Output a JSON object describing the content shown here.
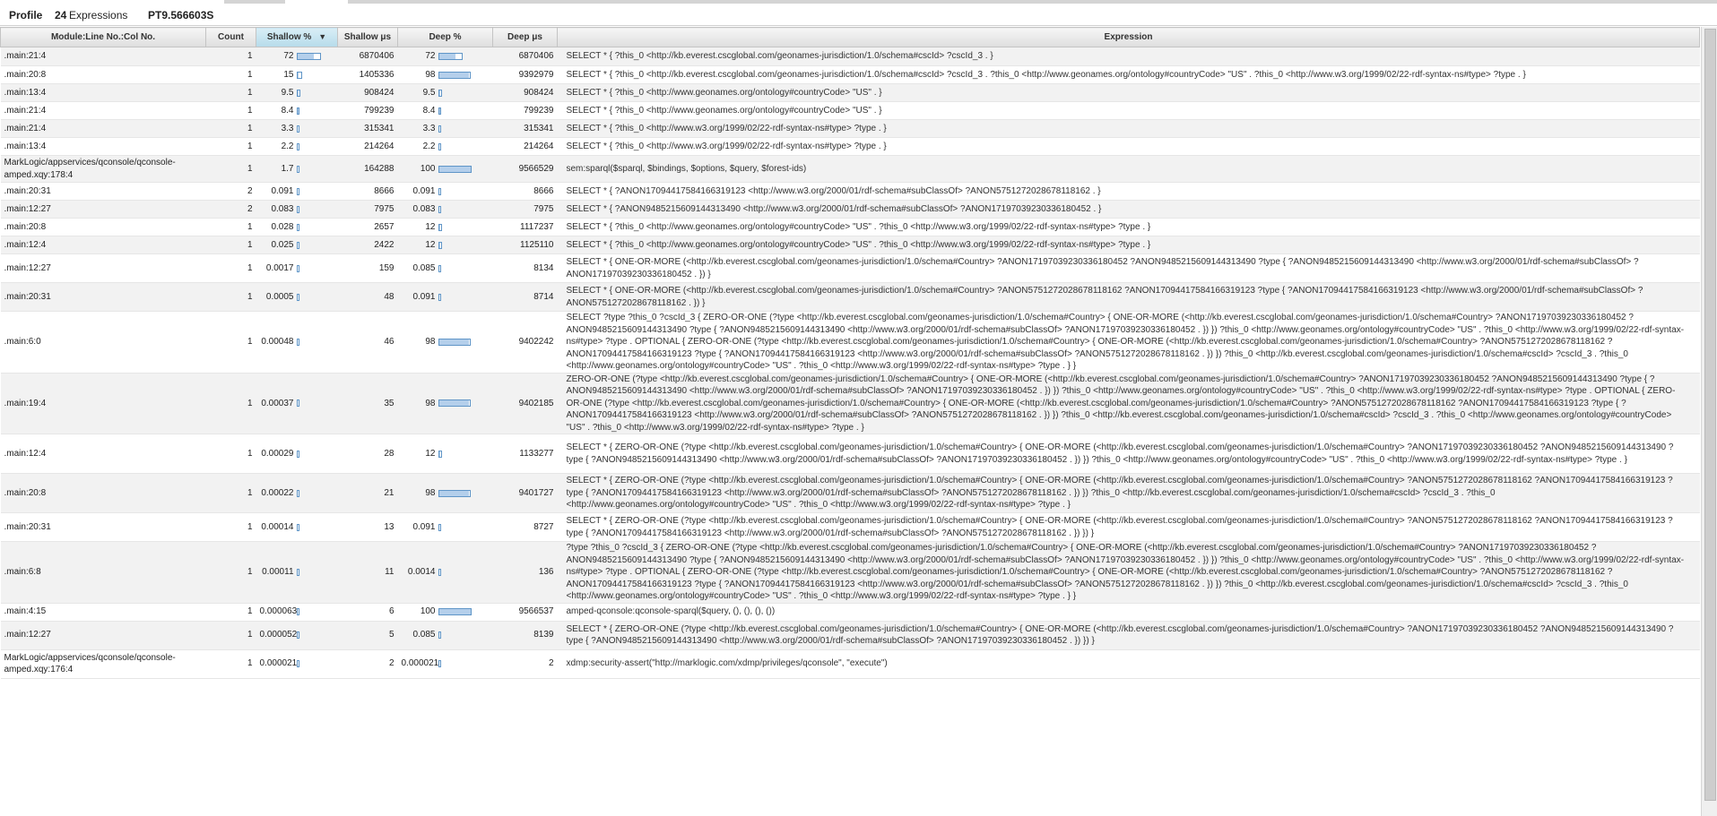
{
  "header": {
    "title": "Profile",
    "expression_count": "24",
    "expressions_label": "Expressions",
    "elapsed": "PT9.566603S"
  },
  "columns": {
    "module": "Module:Line No.:Col No.",
    "count": "Count",
    "shallow_pct": "Shallow %",
    "shallow_us": "Shallow μs",
    "deep_pct": "Deep %",
    "deep_us": "Deep μs",
    "expression": "Expression"
  },
  "sort": {
    "column": "shallow_pct",
    "direction": "descending",
    "arrow": "▼"
  },
  "rows": [
    {
      "module": ".main:21:4",
      "count": "1",
      "shallow_pct": "72",
      "shallow_fill": 0.72,
      "shallow_us": "6870406",
      "deep_pct": "72",
      "deep_fill": 0.72,
      "deep_us": "6870406",
      "expression": "SELECT * { ?this_0 <http://kb.everest.cscglobal.com/geonames-jurisdiction/1.0/schema#cscId> ?cscId_3 . }"
    },
    {
      "module": ".main:20:8",
      "count": "1",
      "shallow_pct": "15",
      "shallow_fill": 0.15,
      "shallow_us": "1405336",
      "deep_pct": "98",
      "deep_fill": 0.98,
      "deep_us": "9392979",
      "expression": "SELECT * { ?this_0 <http://kb.everest.cscglobal.com/geonames-jurisdiction/1.0/schema#cscId> ?cscId_3 . ?this_0 <http://www.geonames.org/ontology#countryCode> \"US\" . ?this_0 <http://www.w3.org/1999/02/22-rdf-syntax-ns#type> ?type . }"
    },
    {
      "module": ".main:13:4",
      "count": "1",
      "shallow_pct": "9.5",
      "shallow_fill": 0.095,
      "shallow_us": "908424",
      "deep_pct": "9.5",
      "deep_fill": 0.095,
      "deep_us": "908424",
      "expression": "SELECT * { ?this_0 <http://www.geonames.org/ontology#countryCode> \"US\" . }"
    },
    {
      "module": ".main:21:4",
      "count": "1",
      "shallow_pct": "8.4",
      "shallow_fill": 0.084,
      "shallow_us": "799239",
      "deep_pct": "8.4",
      "deep_fill": 0.084,
      "deep_us": "799239",
      "expression": "SELECT * { ?this_0 <http://www.geonames.org/ontology#countryCode> \"US\" . }"
    },
    {
      "module": ".main:21:4",
      "count": "1",
      "shallow_pct": "3.3",
      "shallow_fill": 0.033,
      "shallow_us": "315341",
      "deep_pct": "3.3",
      "deep_fill": 0.033,
      "deep_us": "315341",
      "expression": "SELECT * { ?this_0 <http://www.w3.org/1999/02/22-rdf-syntax-ns#type> ?type . }"
    },
    {
      "module": ".main:13:4",
      "count": "1",
      "shallow_pct": "2.2",
      "shallow_fill": 0.022,
      "shallow_us": "214264",
      "deep_pct": "2.2",
      "deep_fill": 0.022,
      "deep_us": "214264",
      "expression": "SELECT * { ?this_0 <http://www.w3.org/1999/02/22-rdf-syntax-ns#type> ?type . }"
    },
    {
      "module": "MarkLogic/appservices/qconsole/qconsole-amped.xqy:178:4",
      "count": "1",
      "shallow_pct": "1.7",
      "shallow_fill": 0.017,
      "shallow_us": "164288",
      "deep_pct": "100",
      "deep_fill": 1.0,
      "deep_us": "9566529",
      "expression": "sem:sparql($sparql, $bindings, $options, $query, $forest-ids)"
    },
    {
      "module": ".main:20:31",
      "count": "2",
      "shallow_pct": "0.091",
      "shallow_fill": 0.00091,
      "shallow_us": "8666",
      "deep_pct": "0.091",
      "deep_fill": 0.00091,
      "deep_us": "8666",
      "expression": "SELECT * { ?ANON17094417584166319123 <http://www.w3.org/2000/01/rdf-schema#subClassOf> ?ANON5751272028678118162 . }"
    },
    {
      "module": ".main:12:27",
      "count": "2",
      "shallow_pct": "0.083",
      "shallow_fill": 0.00083,
      "shallow_us": "7975",
      "deep_pct": "0.083",
      "deep_fill": 0.00083,
      "deep_us": "7975",
      "expression": "SELECT * { ?ANON9485215609144313490 <http://www.w3.org/2000/01/rdf-schema#subClassOf> ?ANON17197039230336180452 . }"
    },
    {
      "module": ".main:20:8",
      "count": "1",
      "shallow_pct": "0.028",
      "shallow_fill": 0.00028,
      "shallow_us": "2657",
      "deep_pct": "12",
      "deep_fill": 0.12,
      "deep_us": "1117237",
      "expression": "SELECT * { ?this_0 <http://www.geonames.org/ontology#countryCode> \"US\" . ?this_0 <http://www.w3.org/1999/02/22-rdf-syntax-ns#type> ?type . }"
    },
    {
      "module": ".main:12:4",
      "count": "1",
      "shallow_pct": "0.025",
      "shallow_fill": 0.00025,
      "shallow_us": "2422",
      "deep_pct": "12",
      "deep_fill": 0.12,
      "deep_us": "1125110",
      "expression": "SELECT * { ?this_0 <http://www.geonames.org/ontology#countryCode> \"US\" . ?this_0 <http://www.w3.org/1999/02/22-rdf-syntax-ns#type> ?type . }"
    },
    {
      "module": ".main:12:27",
      "count": "1",
      "shallow_pct": "0.0017",
      "shallow_fill": 1.7e-05,
      "shallow_us": "159",
      "deep_pct": "0.085",
      "deep_fill": 0.00085,
      "deep_us": "8134",
      "expression": "SELECT * { ONE-OR-MORE (<http://kb.everest.cscglobal.com/geonames-jurisdiction/1.0/schema#Country> ?ANON17197039230336180452 ?ANON9485215609144313490 ?type { ?ANON9485215609144313490 <http://www.w3.org/2000/01/rdf-schema#subClassOf> ?ANON17197039230336180452 . }) }"
    },
    {
      "module": ".main:20:31",
      "count": "1",
      "shallow_pct": "0.0005",
      "shallow_fill": 5e-06,
      "shallow_us": "48",
      "deep_pct": "0.091",
      "deep_fill": 0.00091,
      "deep_us": "8714",
      "expression": "SELECT * { ONE-OR-MORE (<http://kb.everest.cscglobal.com/geonames-jurisdiction/1.0/schema#Country> ?ANON5751272028678118162 ?ANON17094417584166319123 ?type { ?ANON17094417584166319123 <http://www.w3.org/2000/01/rdf-schema#subClassOf> ?ANON5751272028678118162 . }) }"
    },
    {
      "module": ".main:6:0",
      "count": "1",
      "shallow_pct": "0.00048",
      "shallow_fill": 4.8e-06,
      "shallow_us": "46",
      "deep_pct": "98",
      "deep_fill": 0.98,
      "deep_us": "9402242",
      "expression": "SELECT ?type ?this_0 ?cscId_3 { ZERO-OR-ONE (?type <http://kb.everest.cscglobal.com/geonames-jurisdiction/1.0/schema#Country> { ONE-OR-MORE (<http://kb.everest.cscglobal.com/geonames-jurisdiction/1.0/schema#Country> ?ANON17197039230336180452 ?ANON9485215609144313490 ?type { ?ANON9485215609144313490 <http://www.w3.org/2000/01/rdf-schema#subClassOf> ?ANON17197039230336180452 . }) }) ?this_0 <http://www.geonames.org/ontology#countryCode> \"US\" . ?this_0 <http://www.w3.org/1999/02/22-rdf-syntax-ns#type> ?type . OPTIONAL { ZERO-OR-ONE (?type <http://kb.everest.cscglobal.com/geonames-jurisdiction/1.0/schema#Country> { ONE-OR-MORE (<http://kb.everest.cscglobal.com/geonames-jurisdiction/1.0/schema#Country> ?ANON5751272028678118162 ?ANON17094417584166319123 ?type { ?ANON17094417584166319123 <http://www.w3.org/2000/01/rdf-schema#subClassOf> ?ANON5751272028678118162 . }) }) ?this_0 <http://kb.everest.cscglobal.com/geonames-jurisdiction/1.0/schema#cscId> ?cscId_3 . ?this_0 <http://www.geonames.org/ontology#countryCode> \"US\" . ?this_0 <http://www.w3.org/1999/02/22-rdf-syntax-ns#type> ?type . } }"
    },
    {
      "module": ".main:19:4",
      "count": "1",
      "shallow_pct": "0.00037",
      "shallow_fill": 3.7e-06,
      "shallow_us": "35",
      "deep_pct": "98",
      "deep_fill": 0.98,
      "deep_us": "9402185",
      "expression": "ZERO-OR-ONE (?type <http://kb.everest.cscglobal.com/geonames-jurisdiction/1.0/schema#Country> { ONE-OR-MORE (<http://kb.everest.cscglobal.com/geonames-jurisdiction/1.0/schema#Country> ?ANON17197039230336180452 ?ANON9485215609144313490 ?type { ?ANON9485215609144313490 <http://www.w3.org/2000/01/rdf-schema#subClassOf> ?ANON17197039230336180452 . }) }) ?this_0 <http://www.geonames.org/ontology#countryCode> \"US\" . ?this_0 <http://www.w3.org/1999/02/22-rdf-syntax-ns#type> ?type . OPTIONAL { ZERO-OR-ONE (?type <http://kb.everest.cscglobal.com/geonames-jurisdiction/1.0/schema#Country> { ONE-OR-MORE (<http://kb.everest.cscglobal.com/geonames-jurisdiction/1.0/schema#Country> ?ANON5751272028678118162 ?ANON17094417584166319123 ?type { ?ANON17094417584166319123 <http://www.w3.org/2000/01/rdf-schema#subClassOf> ?ANON5751272028678118162 . }) }) ?this_0 <http://kb.everest.cscglobal.com/geonames-jurisdiction/1.0/schema#cscId> ?cscId_3 . ?this_0 <http://www.geonames.org/ontology#countryCode> \"US\" . ?this_0 <http://www.w3.org/1999/02/22-rdf-syntax-ns#type> ?type . }"
    },
    {
      "module": ".main:12:4",
      "count": "1",
      "shallow_pct": "0.00029",
      "shallow_fill": 2.9e-06,
      "shallow_us": "28",
      "deep_pct": "12",
      "deep_fill": 0.12,
      "deep_us": "1133277",
      "expression": "SELECT * { ZERO-OR-ONE (?type <http://kb.everest.cscglobal.com/geonames-jurisdiction/1.0/schema#Country> { ONE-OR-MORE (<http://kb.everest.cscglobal.com/geonames-jurisdiction/1.0/schema#Country> ?ANON17197039230336180452 ?ANON9485215609144313490 ?type { ?ANON9485215609144313490 <http://www.w3.org/2000/01/rdf-schema#subClassOf> ?ANON17197039230336180452 . }) }) ?this_0 <http://www.geonames.org/ontology#countryCode> \"US\" . ?this_0 <http://www.w3.org/1999/02/22-rdf-syntax-ns#type> ?type . }"
    },
    {
      "module": ".main:20:8",
      "count": "1",
      "shallow_pct": "0.00022",
      "shallow_fill": 2.2e-06,
      "shallow_us": "21",
      "deep_pct": "98",
      "deep_fill": 0.98,
      "deep_us": "9401727",
      "expression": "SELECT * { ZERO-OR-ONE (?type <http://kb.everest.cscglobal.com/geonames-jurisdiction/1.0/schema#Country> { ONE-OR-MORE (<http://kb.everest.cscglobal.com/geonames-jurisdiction/1.0/schema#Country> ?ANON5751272028678118162 ?ANON17094417584166319123 ?type { ?ANON17094417584166319123 <http://www.w3.org/2000/01/rdf-schema#subClassOf> ?ANON5751272028678118162 . }) }) ?this_0 <http://kb.everest.cscglobal.com/geonames-jurisdiction/1.0/schema#cscId> ?cscId_3 . ?this_0 <http://www.geonames.org/ontology#countryCode> \"US\" . ?this_0 <http://www.w3.org/1999/02/22-rdf-syntax-ns#type> ?type . }"
    },
    {
      "module": ".main:20:31",
      "count": "1",
      "shallow_pct": "0.00014",
      "shallow_fill": 1.4e-06,
      "shallow_us": "13",
      "deep_pct": "0.091",
      "deep_fill": 0.00091,
      "deep_us": "8727",
      "expression": "SELECT * { ZERO-OR-ONE (?type <http://kb.everest.cscglobal.com/geonames-jurisdiction/1.0/schema#Country> { ONE-OR-MORE (<http://kb.everest.cscglobal.com/geonames-jurisdiction/1.0/schema#Country> ?ANON5751272028678118162 ?ANON17094417584166319123 ?type { ?ANON17094417584166319123 <http://www.w3.org/2000/01/rdf-schema#subClassOf> ?ANON5751272028678118162 . }) }) }"
    },
    {
      "module": ".main:6:8",
      "count": "1",
      "shallow_pct": "0.00011",
      "shallow_fill": 1.1e-06,
      "shallow_us": "11",
      "deep_pct": "0.0014",
      "deep_fill": 1.4e-05,
      "deep_us": "136",
      "expression": "?type ?this_0 ?cscId_3 { ZERO-OR-ONE (?type <http://kb.everest.cscglobal.com/geonames-jurisdiction/1.0/schema#Country> { ONE-OR-MORE (<http://kb.everest.cscglobal.com/geonames-jurisdiction/1.0/schema#Country> ?ANON17197039230336180452 ?ANON9485215609144313490 ?type { ?ANON9485215609144313490 <http://www.w3.org/2000/01/rdf-schema#subClassOf> ?ANON17197039230336180452 . }) }) ?this_0 <http://www.geonames.org/ontology#countryCode> \"US\" . ?this_0 <http://www.w3.org/1999/02/22-rdf-syntax-ns#type> ?type . OPTIONAL { ZERO-OR-ONE (?type <http://kb.everest.cscglobal.com/geonames-jurisdiction/1.0/schema#Country> { ONE-OR-MORE (<http://kb.everest.cscglobal.com/geonames-jurisdiction/1.0/schema#Country> ?ANON5751272028678118162 ?ANON17094417584166319123 ?type { ?ANON17094417584166319123 <http://www.w3.org/2000/01/rdf-schema#subClassOf> ?ANON5751272028678118162 . }) }) ?this_0 <http://kb.everest.cscglobal.com/geonames-jurisdiction/1.0/schema#cscId> ?cscId_3 . ?this_0 <http://www.geonames.org/ontology#countryCode> \"US\" . ?this_0 <http://www.w3.org/1999/02/22-rdf-syntax-ns#type> ?type . } }"
    },
    {
      "module": ".main:4:15",
      "count": "1",
      "shallow_pct": "0.000063",
      "shallow_fill": 6.3e-07,
      "shallow_us": "6",
      "deep_pct": "100",
      "deep_fill": 1.0,
      "deep_us": "9566537",
      "expression": "amped-qconsole:qconsole-sparql($query, (), (), (), ())"
    },
    {
      "module": ".main:12:27",
      "count": "1",
      "shallow_pct": "0.000052",
      "shallow_fill": 5.2e-07,
      "shallow_us": "5",
      "deep_pct": "0.085",
      "deep_fill": 0.00085,
      "deep_us": "8139",
      "expression": "SELECT * { ZERO-OR-ONE (?type <http://kb.everest.cscglobal.com/geonames-jurisdiction/1.0/schema#Country> { ONE-OR-MORE (<http://kb.everest.cscglobal.com/geonames-jurisdiction/1.0/schema#Country> ?ANON17197039230336180452 ?ANON9485215609144313490 ?type { ?ANON9485215609144313490 <http://www.w3.org/2000/01/rdf-schema#subClassOf> ?ANON17197039230336180452 . }) }) }"
    },
    {
      "module": "MarkLogic/appservices/qconsole/qconsole-amped.xqy:176:4",
      "count": "1",
      "shallow_pct": "0.000021",
      "shallow_fill": 2.1e-07,
      "shallow_us": "2",
      "deep_pct": "0.000021",
      "deep_fill": 2.1e-07,
      "deep_us": "2",
      "expression": "xdmp:security-assert(\"http://marklogic.com/xdmp/privileges/qconsole\", \"execute\")"
    }
  ]
}
